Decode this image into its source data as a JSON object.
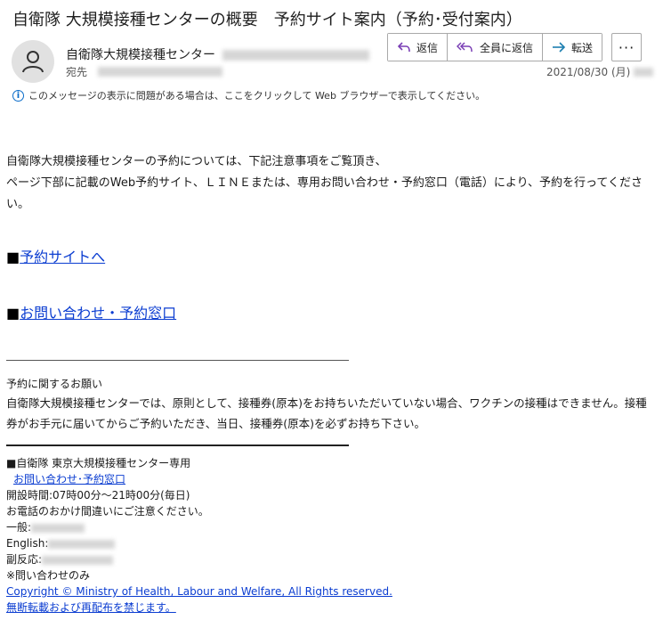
{
  "email": {
    "subject": "自衛隊 大規模接種センターの概要　予約サイト案内（予約･受付案内）",
    "sender_name": "自衛隊大規模接種センター",
    "to_label": "宛先",
    "date": "2021/08/30 (月)",
    "info_text": "このメッセージの表示に問題がある場合は、ここをクリックして Web ブラウザーで表示してください。"
  },
  "toolbar": {
    "reply_label": "返信",
    "reply_all_label": "全員に返信",
    "forward_label": "転送",
    "more_label": "···"
  },
  "body": {
    "intro_line1": "自衛隊大規模接種センターの予約については、下記注意事項をご覧頂き、",
    "intro_line2": "ページ下部に記載のWeb予約サイト、ＬＩＮＥまたは、専用お問い合わせ・予約窓口（電話）により、予約を行ってください。",
    "bullet": "■",
    "link1": "予約サイトへ",
    "link2": "お問い合わせ・予約窓口",
    "notice_title": "予約に関するお願い",
    "notice_text": "自衛隊大規模接種センターでは、原則として、接種券(原本)をお持ちいただいていない場合、ワクチンの接種はできません。接種券がお手元に届いてからご予約いただき、当日、接種券(原本)を必ずお持ち下さい。",
    "footer_title": "■自衛隊 東京大規模接種センター専用",
    "footer_link": "お問い合わせ･予約窓口",
    "hours": "開設時間:07時00分～21時00分(毎日)",
    "caution": "お電話のおかけ間違いにご注意ください。",
    "general_label": "一般:",
    "english_label": "English:",
    "side_label": "副反応:",
    "inquiry_only": "※問い合わせのみ",
    "copyright": "Copyright © Ministry of Health, Labour and Welfare, All Rights reserved.",
    "no_reprint": "無断転載および再配布を禁じます。"
  }
}
